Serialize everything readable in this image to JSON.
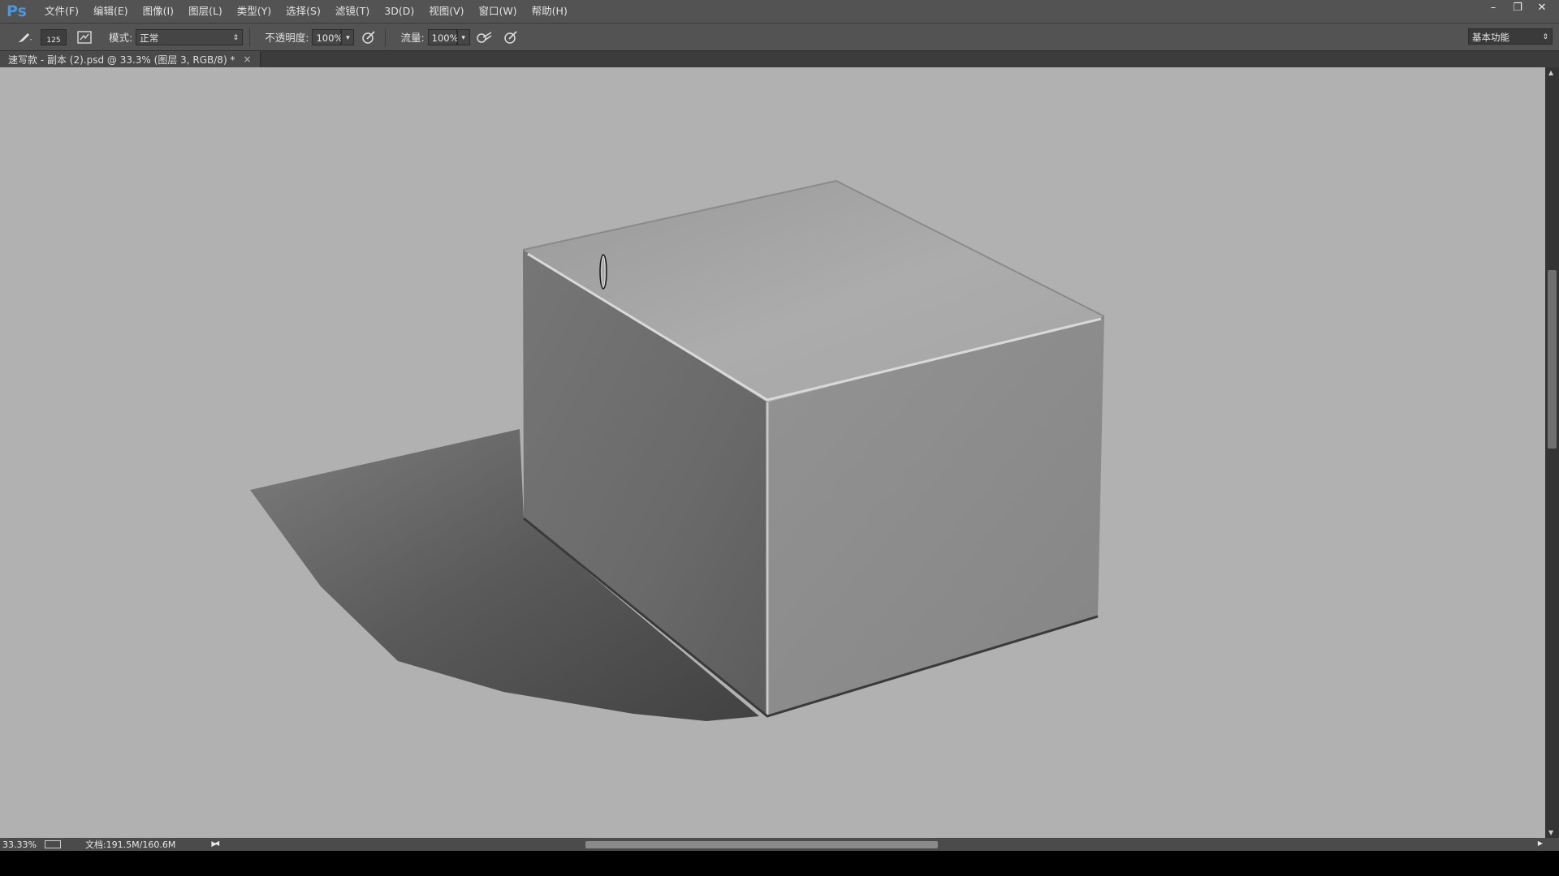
{
  "app": {
    "logo": "Ps"
  },
  "menu": [
    "文件(F)",
    "编辑(E)",
    "图像(I)",
    "图层(L)",
    "类型(Y)",
    "选择(S)",
    "滤镜(T)",
    "3D(D)",
    "视图(V)",
    "窗口(W)",
    "帮助(H)"
  ],
  "window_controls": {
    "minimize": "–",
    "restore": "❐",
    "close": "✕"
  },
  "options": {
    "brush_size": "125",
    "mode_label": "模式:",
    "mode_value": "正常",
    "opacity_label": "不透明度:",
    "opacity_value": "100%",
    "flow_label": "流量:",
    "flow_value": "100%",
    "workspace": "基本功能"
  },
  "document_tab": {
    "title": "速写款 - 副本 (2).psd @ 33.3% (图层 3, RGB/8) *",
    "close": "×"
  },
  "status": {
    "zoom": "33.33%",
    "doc_info": "文档:191.5M/160.6M"
  },
  "icons": [
    "brush-tool-icon",
    "brush-panel-icon",
    "airbrush-icon",
    "tablet-pressure-opacity-icon",
    "tablet-pressure-size-icon"
  ]
}
